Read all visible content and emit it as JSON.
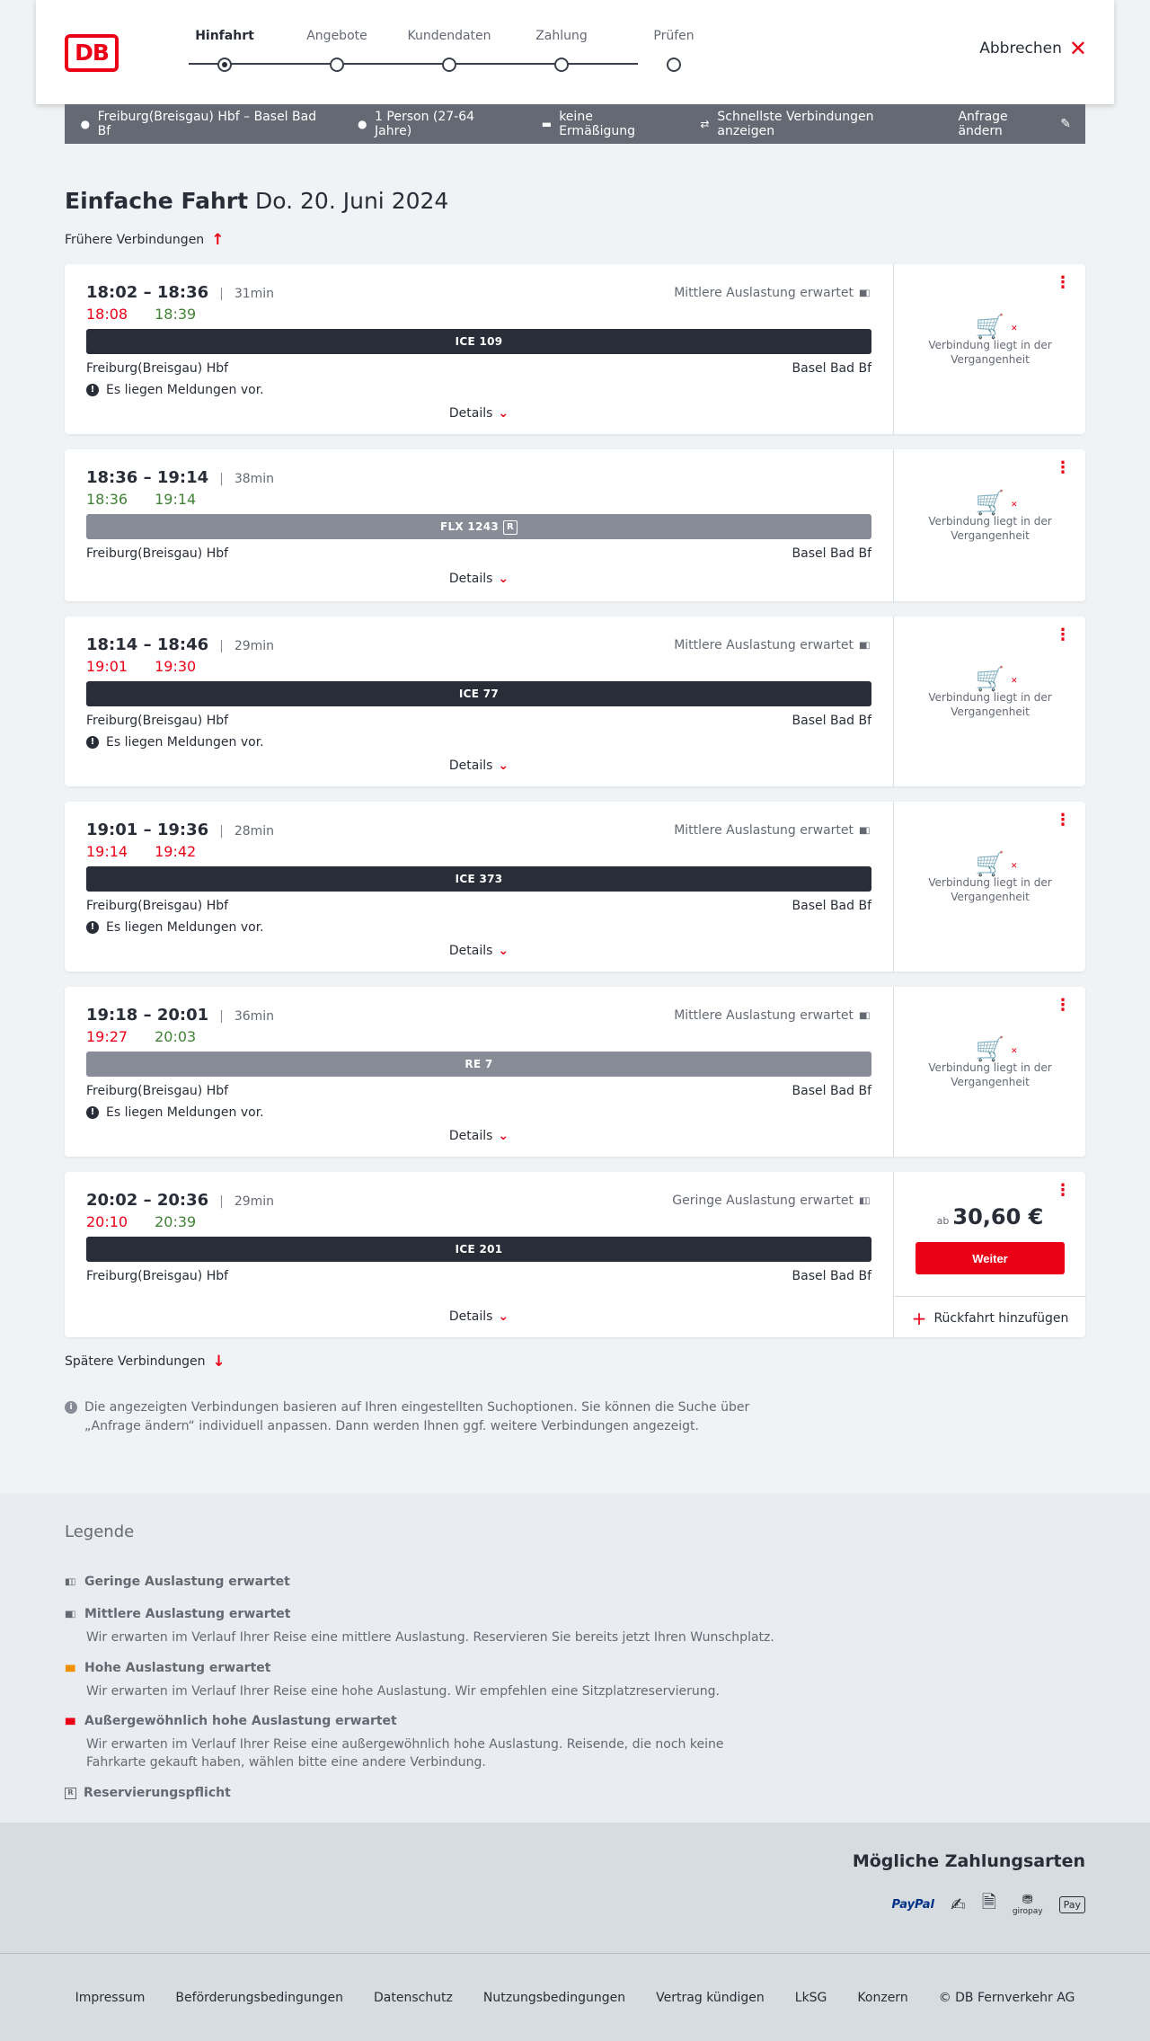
{
  "header": {
    "logo": "DB",
    "steps": [
      "Hinfahrt",
      "Angebote",
      "Kundendaten",
      "Zahlung",
      "Prüfen"
    ],
    "active_step": 0,
    "cancel_label": "Abbrechen"
  },
  "searchbar": {
    "route": "Freiburg(Breisgau) Hbf – Basel Bad Bf",
    "travellers": "1 Person (27-64 Jahre)",
    "discount": "keine Ermäßigung",
    "fastest": "Schnellste Verbindungen anzeigen",
    "change": "Anfrage ändern"
  },
  "title": {
    "type": "Einfache Fahrt",
    "date": "Do. 20. Juni 2024"
  },
  "earlier": "Frühere Verbindungen",
  "later": "Spätere Verbindungen",
  "details_label": "Details",
  "past_text": "Verbindung liegt in der Vergangenheit",
  "connections": [
    {
      "times": "18:02 – 18:36",
      "duration": "31min",
      "rt_dep": "18:08",
      "rt_arr": "18:39",
      "load": "Mittlere Auslastung erwartet",
      "train": "ICE 109",
      "from": "Freiburg(Breisgau) Hbf",
      "to": "Basel Bad Bf",
      "message": "Es liegen Meldungen vor."
    },
    {
      "times": "18:36 – 19:14",
      "duration": "38min",
      "rt_dep": "18:36",
      "rt_arr": "19:14",
      "train": "FLX 1243",
      "reservation": "R",
      "from": "Freiburg(Breisgau) Hbf",
      "to": "Basel Bad Bf"
    },
    {
      "times": "18:14 – 18:46",
      "duration": "29min",
      "rt_dep": "19:01",
      "rt_arr": "19:30",
      "load": "Mittlere Auslastung erwartet",
      "train": "ICE 77",
      "from": "Freiburg(Breisgau) Hbf",
      "to": "Basel Bad Bf",
      "message": "Es liegen Meldungen vor."
    },
    {
      "times": "19:01 – 19:36",
      "duration": "28min",
      "rt_dep": "19:14",
      "rt_arr": "19:42",
      "load": "Mittlere Auslastung erwartet",
      "train": "ICE 373",
      "from": "Freiburg(Breisgau) Hbf",
      "to": "Basel Bad Bf",
      "message": "Es liegen Meldungen vor."
    },
    {
      "times": "19:18 – 20:01",
      "duration": "36min",
      "rt_dep": "19:27",
      "rt_arr": "20:03",
      "load": "Mittlere Auslastung erwartet",
      "train": "RE 7",
      "from": "Freiburg(Breisgau) Hbf",
      "to": "Basel Bad Bf",
      "message": "Es liegen Meldungen vor."
    },
    {
      "times": "20:02 – 20:36",
      "duration": "29min",
      "rt_dep": "20:10",
      "rt_arr": "20:39",
      "load": "Geringe Auslastung erwartet",
      "train": "ICE 201",
      "from": "Freiburg(Breisgau) Hbf",
      "to": "Basel Bad Bf",
      "price_prefix": "ab",
      "price": "30,60 €",
      "book": "Weiter",
      "return": "Rückfahrt hinzufügen"
    }
  ],
  "info": "Die angezeigten Verbindungen basieren auf Ihren eingestellten Suchoptionen. Sie können die Suche über „Anfrage ändern“ individuell anpassen. Dann werden Ihnen ggf. weitere Verbindungen angezeigt.",
  "legend": {
    "title": "Legende",
    "items": [
      {
        "title": "Geringe Auslastung erwartet"
      },
      {
        "title": "Mittlere Auslastung erwartet",
        "desc": "Wir erwarten im Verlauf Ihrer Reise eine mittlere Auslastung. Reservieren Sie bereits jetzt Ihren Wunschplatz."
      },
      {
        "title": "Hohe Auslastung erwartet",
        "desc": "Wir erwarten im Verlauf Ihrer Reise eine hohe Auslastung. Wir empfehlen eine Sitzplatzreservierung."
      },
      {
        "title": "Außergewöhnlich hohe Auslastung erwartet",
        "desc": "Wir erwarten im Verlauf Ihrer Reise eine außergewöhnlich hohe Auslastung. Reisende, die noch keine Fahrkarte gekauft haben, wählen bitte eine andere Verbindung."
      },
      {
        "title": "Reservierungspflicht"
      }
    ]
  },
  "payment": {
    "title": "Mögliche Zahlungsarten",
    "paypal": "PayPal",
    "giropay": "giropay",
    "applepay": "Pay"
  },
  "footer": [
    "Impressum",
    "Beförderungsbedingungen",
    "Datenschutz",
    "Nutzungsbedingungen",
    "Vertrag kündigen",
    "LkSG",
    "Konzern",
    "© DB Fernverkehr AG"
  ],
  "colors": {
    "brand": "#ec0016",
    "late": "#ec0016",
    "ontime": "#408335",
    "dark": "#282d37"
  }
}
